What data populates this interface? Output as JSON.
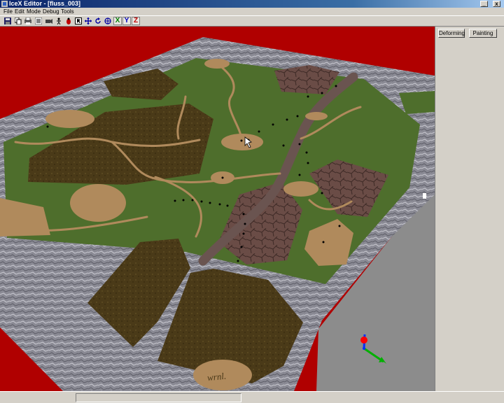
{
  "window": {
    "title": "IceX Editor - [fluss_003]",
    "minimize_label": "_",
    "close_label": "x"
  },
  "menubar": {
    "items": [
      {
        "label": "File"
      },
      {
        "label": "Edit"
      },
      {
        "label": "Mode"
      },
      {
        "label": "Debug"
      },
      {
        "label": "Tools"
      }
    ]
  },
  "toolbar": {
    "icons": [
      "save-icon",
      "copy-icon",
      "print-icon",
      "list-icon",
      "camera-icon",
      "walk-icon",
      "bug-icon",
      "select-icon",
      "move-icon",
      "rotate-icon",
      "scale-icon"
    ],
    "axis_x": "X",
    "axis_y": "Y",
    "axis_z": "Z",
    "axis_colors": {
      "x": "#008000",
      "y": "#0000c0",
      "z": "#c00000"
    }
  },
  "side_panel": {
    "deforming_label": "Deforming",
    "painting_label": "Painting"
  },
  "scene": {
    "background_color": "#b00000",
    "ground_text": "wrnl.",
    "gizmo_colors": {
      "x": "#00b000",
      "y": "#0030ff",
      "z": "#ff0000"
    }
  },
  "statusbar": {
    "text": ""
  }
}
